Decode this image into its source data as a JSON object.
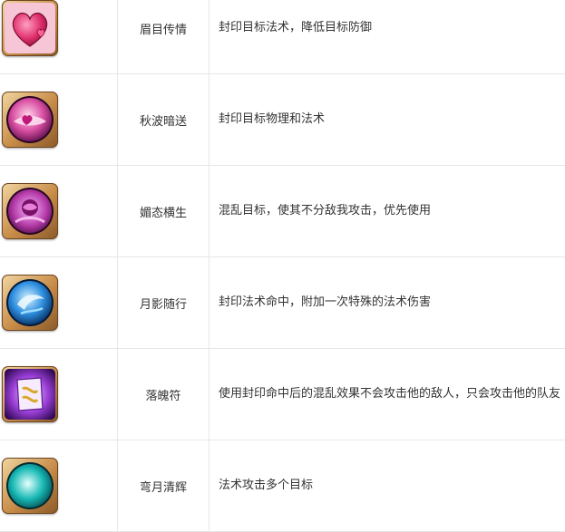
{
  "skills": [
    {
      "icon": "heart-icon",
      "name": "眉目传情",
      "desc": "封印目标法术，降低目标防御"
    },
    {
      "icon": "pink-heart-orb-icon",
      "name": "秋波暗送",
      "desc": "封印目标物理和法术"
    },
    {
      "icon": "pink-rose-orb-icon",
      "name": "媚态横生",
      "desc": "混乱目标，使其不分敌我攻击，优先使用"
    },
    {
      "icon": "blue-moon-orb-icon",
      "name": "月影随行",
      "desc": "封印法术命中，附加一次特殊的法术伤害"
    },
    {
      "icon": "purple-scroll-icon",
      "name": "落魄符",
      "desc": "使用封印命中后的混乱效果不会攻击他的敌人，只会攻击他的队友"
    },
    {
      "icon": "cyan-crescent-orb-icon",
      "name": "弯月清辉",
      "desc": "法术攻击多个目标"
    }
  ],
  "colors": {
    "border": "#e6e6e6",
    "text": "#333333",
    "frame_gold": "#c78b47"
  }
}
